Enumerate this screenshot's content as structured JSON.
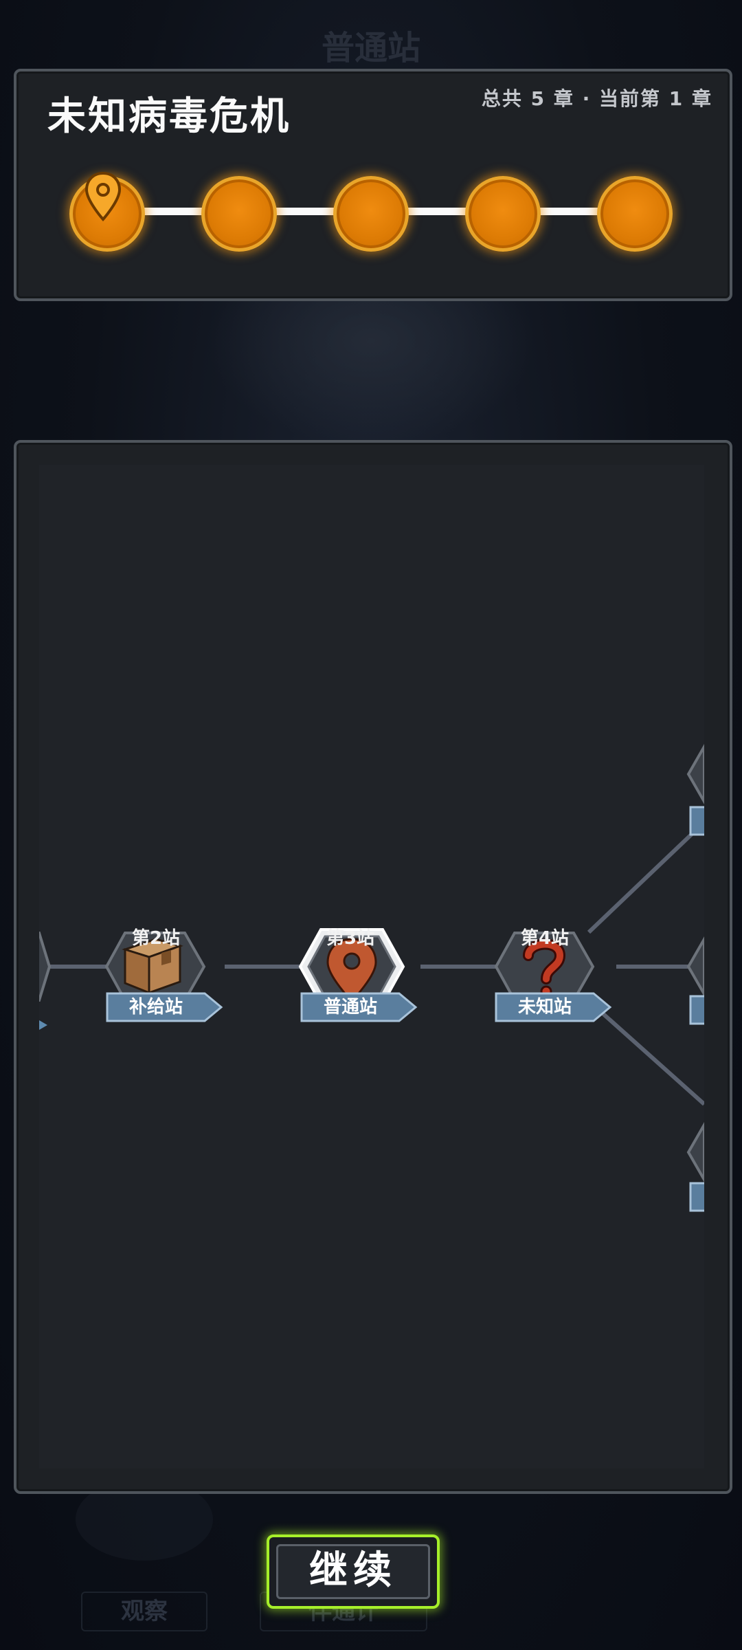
{
  "background": {
    "title": "普通站",
    "btn_left": "观察",
    "btn_right": "伴通计"
  },
  "chapter": {
    "title": "未知病毒危机",
    "info": "总共 5 章 · 当前第 1 章",
    "total": 5,
    "current": 1
  },
  "stations": [
    {
      "number": "第2站",
      "type": "补给站",
      "icon": "box-icon"
    },
    {
      "number": "第3站",
      "type": "普通站",
      "icon": "map-pin-icon",
      "selected": true
    },
    {
      "number": "第4站",
      "type": "未知站",
      "icon": "question-icon"
    }
  ],
  "continue_label": "继续",
  "colors": {
    "accent_orange": "#de7c05",
    "accent_green": "#a6ef2a",
    "tag_blue": "#5a7e9e"
  }
}
